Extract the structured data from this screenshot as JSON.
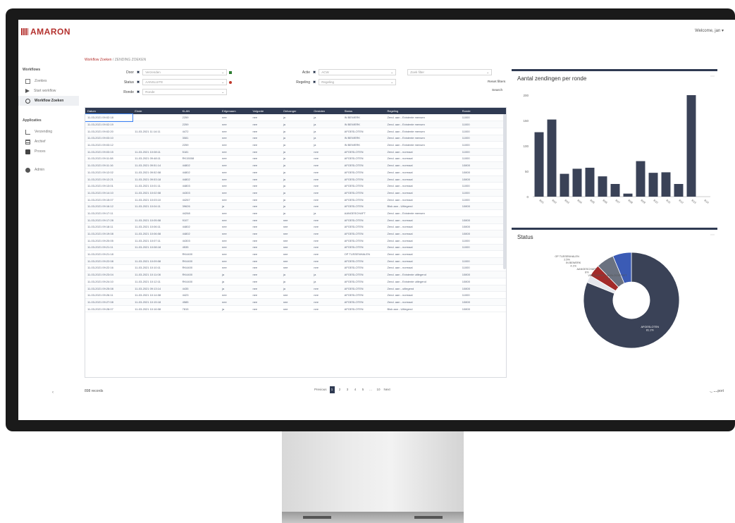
{
  "app": {
    "logo": "AMARON",
    "user": "Welcome, jan ▾"
  },
  "breadcrumb": {
    "parent": "Workflow Zoeken",
    "current": "ZENDING ZOEKEN"
  },
  "sidebar": {
    "sections": [
      {
        "title": "Workflows",
        "items": [
          {
            "label": "Zoekies",
            "icon": "square-icon"
          },
          {
            "label": "Start workflow",
            "icon": "play-icon"
          },
          {
            "label": "Workflow Zoeken",
            "icon": "search-icon",
            "active": true
          }
        ]
      },
      {
        "title": "Applicaties",
        "items": [
          {
            "label": "Verzending",
            "icon": "tree-icon"
          },
          {
            "label": "Archief",
            "icon": "table-icon"
          },
          {
            "label": "Proces",
            "icon": "folder-icon"
          }
        ]
      },
      {
        "title": "",
        "items": [
          {
            "label": "Admin",
            "icon": "gear-icon"
          }
        ]
      }
    ],
    "collapse": "‹"
  },
  "filters": {
    "left": [
      {
        "label": "Door",
        "value": "Verzenden"
      },
      {
        "label": "Status",
        "value": "AANSLUITE"
      },
      {
        "label": "Ronde",
        "value": "Ronde"
      }
    ],
    "right": [
      {
        "label": "Actie",
        "value": "ACW"
      },
      {
        "label": "Regeling",
        "value": "Regeling"
      }
    ],
    "extra_input": "Zoek filter",
    "reset": "Reset filters",
    "search": "Search"
  },
  "table": {
    "columns": [
      "Datum",
      "Einde",
      "KLAN",
      "Erfgenaam",
      "Volgorde",
      "Ontvanger",
      "Gesloten",
      "Status",
      "Regeling",
      "Ronde"
    ],
    "rows": [
      [
        "11-03-2021 09:02:18",
        "",
        "2259",
        "nee",
        "nee",
        "ja",
        "ja",
        "IN BEWERK",
        "Zend. aan - Existente mensen",
        "11000"
      ],
      [
        "11-03-2021 09:02:19",
        "",
        "2259",
        "nee",
        "nee",
        "ja",
        "ja",
        "IN BEWERK",
        "Zend. aan - Existente mensen",
        "11000"
      ],
      [
        "11-03-2021 09:02:20",
        "11-03-2021 11:14:11",
        "4472",
        "nee",
        "nee",
        "ja",
        "ja",
        "AFGESLOTEN",
        "Zend. aan - Existente mensen",
        "11000"
      ],
      [
        "11-03-2021 09:03:10",
        "",
        "3081",
        "nee",
        "nee",
        "ja",
        "ja",
        "IN BEWERK",
        "Zend. aan - Existente mensen",
        "11000"
      ],
      [
        "11-03-2021 09:03:12",
        "",
        "2259",
        "nee",
        "nee",
        "ja",
        "ja",
        "IN BEWERK",
        "Zend. aan - Existente mensen",
        "11000"
      ],
      [
        "11-03-2021 09:03:15",
        "11-03-2021 10:08:11",
        "5181",
        "nee",
        "nee",
        "ja",
        "nee",
        "AFGESLOTEN",
        "Zend. aan - normaal",
        "11000"
      ],
      [
        "11-03-2021 09:11:08",
        "11-03-2021 09:48:11",
        "RK15008",
        "nee",
        "nee",
        "ja",
        "nee",
        "AFGESLOTEN",
        "Zend. aan - normaal",
        "11000"
      ],
      [
        "11-03-2021 09:11:16",
        "11-03-2021 09:51:14",
        "44802",
        "nee",
        "nee",
        "ja",
        "nee",
        "AFGESLOTEN",
        "Zend. aan - normaal",
        "10800"
      ],
      [
        "11-03-2021 09:12:02",
        "11-03-2021 09:52:08",
        "44802",
        "nee",
        "nee",
        "ja",
        "nee",
        "AFGESLOTEN",
        "Zend. aan - normaal",
        "10800"
      ],
      [
        "11-03-2021 09:12:21",
        "11-03-2021 09:53:18",
        "44802",
        "nee",
        "nee",
        "ja",
        "nee",
        "AFGESLOTEN",
        "Zend. aan - normaal",
        "10800"
      ],
      [
        "11-03-2021 09:13:01",
        "11-03-2021 10:01:11",
        "44803",
        "nee",
        "nee",
        "ja",
        "nee",
        "AFGESLOTEN",
        "Zend. aan - normaal",
        "11000"
      ],
      [
        "11-03-2021 09:14:10",
        "11-03-2021 10:02:08",
        "44303",
        "nee",
        "nee",
        "ja",
        "nee",
        "AFGESLOTEN",
        "Zend. aan - normaal",
        "11000"
      ],
      [
        "11-03-2021 09:15:07",
        "11-03-2021 10:03:10",
        "44267",
        "nee",
        "nee",
        "ja",
        "nee",
        "AFGESLOTEN",
        "Zend. aan - normaal",
        "11000"
      ],
      [
        "11-03-2021 09:16:12",
        "11-03-2021 10:04:11",
        "39626",
        "ja",
        "nee",
        "ja",
        "nee",
        "AFGESLOTEN",
        "Blok aan - Uitlegend",
        "10800"
      ],
      [
        "11-03-2021 09:17:11",
        "",
        "44268",
        "nee",
        "nee",
        "ja",
        "ja",
        "AANGESCHAFT",
        "Zend. aan - Existente mensen",
        ""
      ],
      [
        "11-03-2021 09:17:28",
        "11-03-2021 10:05:08",
        "9107",
        "nee",
        "nee",
        "nee",
        "nee",
        "AFGESLOTEN",
        "Zend. aan - normaal",
        "10800"
      ],
      [
        "11-03-2021 09:18:11",
        "11-03-2021 10:06:11",
        "44802",
        "nee",
        "nee",
        "nee",
        "nee",
        "AFGESLOTEN",
        "Zend. aan - normaal",
        "10800"
      ],
      [
        "11-03-2021 09:19:08",
        "11-03-2021 10:06:08",
        "44802",
        "nee",
        "nee",
        "nee",
        "nee",
        "AFGESLOTEN",
        "Zend. aan - normaal",
        "10800"
      ],
      [
        "11-03-2021 09:20:05",
        "11-03-2021 10:07:11",
        "44303",
        "nee",
        "nee",
        "nee",
        "nee",
        "AFGESLOTEN",
        "Zend. aan - normaal",
        "11000"
      ],
      [
        "11-03-2021 09:21:11",
        "11-03-2021 10:08:18",
        "4535",
        "nee",
        "nee",
        "nee",
        "nee",
        "AFGESLOTEN",
        "Zend. aan - normaal",
        "11000"
      ],
      [
        "11-03-2021 09:21:18",
        "",
        "RK4400",
        "nee",
        "nee",
        "nee",
        "nee",
        "OP TUSSENHALEN",
        "Zend. aan - normaal",
        ""
      ],
      [
        "11-03-2021 09:22:08",
        "11-03-2021 10:09:08",
        "RK4400",
        "nee",
        "nee",
        "nee",
        "nee",
        "AFGESLOTEN",
        "Zend. aan - normaal",
        "11000"
      ],
      [
        "11-03-2021 09:22:16",
        "11-03-2021 10:10:11",
        "RK4400",
        "nee",
        "nee",
        "nee",
        "nee",
        "AFGESLOTEN",
        "Zend. aan - normaal",
        "11000"
      ],
      [
        "11-03-2021 09:23:04",
        "11-03-2021 10:11:08",
        "RK4400",
        "ja",
        "nee",
        "ja",
        "ja",
        "AFGESLOTEN",
        "Zend. aan - Existente uitlegend",
        "10800"
      ],
      [
        "11-03-2021 09:24:10",
        "11-03-2021 10:12:11",
        "RK4400",
        "ja",
        "nee",
        "ja",
        "ja",
        "AFGESLOTEN",
        "Zend. aan - Existente uitlegend",
        "10800"
      ],
      [
        "11-03-2021 09:25:08",
        "11-03-2021 09:13:14",
        "4435",
        "ja",
        "nee",
        "ja",
        "nee",
        "AFGESLOTEN",
        "Zend. aan - uitlegend",
        "10800"
      ],
      [
        "11-03-2021 09:26:11",
        "11-03-2021 10:14:08",
        "4423",
        "nee",
        "nee",
        "nee",
        "nee",
        "AFGESLOTEN",
        "Zend. aan - normaal",
        "11000"
      ],
      [
        "11-03-2021 09:27:08",
        "11-03-2021 10:15:18",
        "4585",
        "nee",
        "nee",
        "nee",
        "nee",
        "AFGESLOTEN",
        "Zend. aan - normaal",
        "10800"
      ],
      [
        "11-03-2021 09:28:07",
        "11-03-2021 10:16:08",
        "7815",
        "ja",
        "nee",
        "nee",
        "nee",
        "AFGESLOTEN",
        "Blok aan - Uitlegend",
        "10800"
      ]
    ]
  },
  "footer": {
    "records": "898 records",
    "pager": [
      "Previous",
      "1",
      "2",
      "3",
      "4",
      "5",
      "...",
      "10",
      "Next"
    ],
    "active_page": "1",
    "export": "Export"
  },
  "chart_data": [
    {
      "type": "bar",
      "title": "Aantal zendingen per ronde",
      "categories": [
        "R01",
        "R02",
        "R03",
        "R04",
        "R05",
        "R06",
        "R07",
        "R08",
        "R09",
        "R10",
        "R11",
        "R12",
        "R13",
        "R14"
      ],
      "values": [
        127,
        152,
        45,
        55,
        57,
        40,
        25,
        6,
        70,
        47,
        48,
        25,
        200,
        0
      ],
      "ylim": [
        0,
        200
      ],
      "yticks": [
        0,
        50,
        100,
        150,
        200
      ],
      "color": "#3a4257"
    },
    {
      "type": "pie",
      "title": "Status",
      "donut": true,
      "slices": [
        {
          "label": "AFGESLOTEN",
          "value": 81.1,
          "color": "#3a4257"
        },
        {
          "label": "OP TUSSENHALEN",
          "value": 2.5,
          "color": "#e4e6ec"
        },
        {
          "label": "IN BEWERK",
          "value": 4.1,
          "color": "#a32a2a"
        },
        {
          "label": "AANGESCHAFT",
          "value": 6.0,
          "color": "#6b7280"
        },
        {
          "label": "VERZONDEN VIA BLOCKPOST",
          "value": 6.3,
          "color": "#3b5bb5"
        }
      ]
    }
  ]
}
